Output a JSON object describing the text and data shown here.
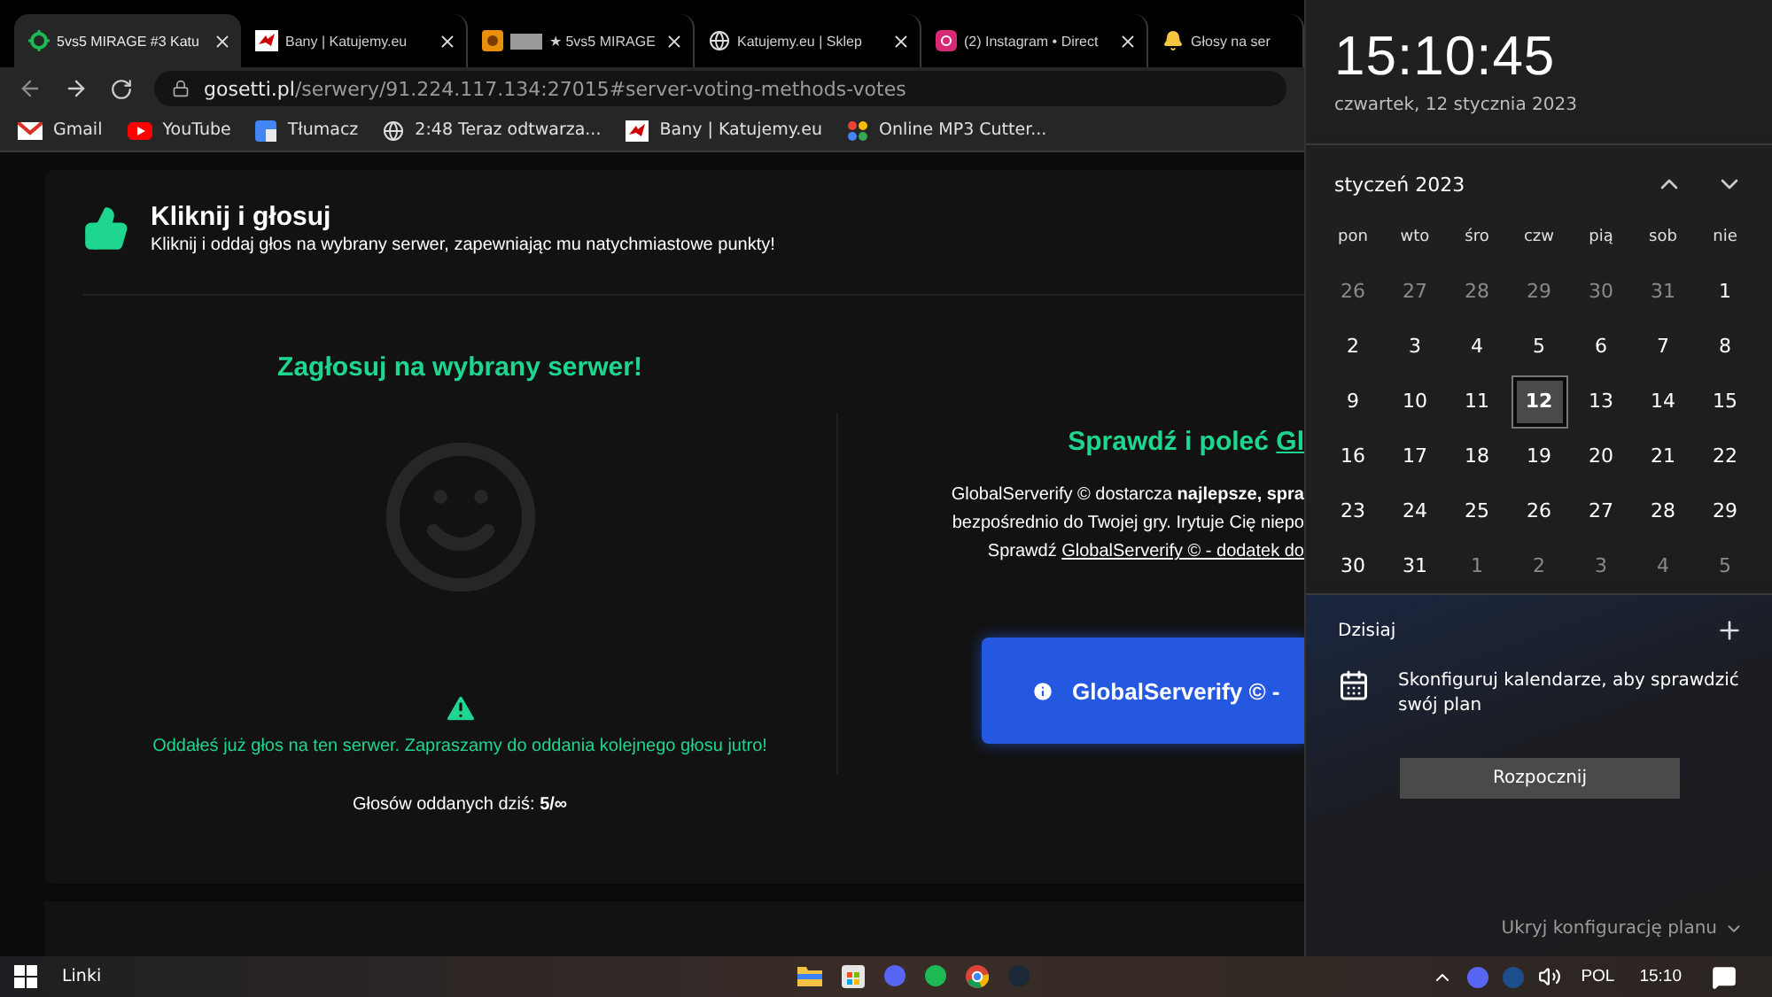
{
  "browser": {
    "tabs": [
      {
        "title": "5vs5 MIRAGE #3 Katu",
        "selected": true,
        "redacted": false
      },
      {
        "title": "Bany | Katujemy.eu",
        "selected": false,
        "redacted": false
      },
      {
        "title": "★ 5vs5 MIRAGE",
        "selected": false,
        "redacted": true
      },
      {
        "title": "Katujemy.eu | Sklep",
        "selected": false,
        "redacted": false
      },
      {
        "title": "(2) Instagram • Direct",
        "selected": false,
        "redacted": false
      },
      {
        "title": "Głosy na ser",
        "selected": false,
        "redacted": false
      }
    ],
    "address": {
      "host": "gosetti.pl",
      "path": "/serwery/91.224.117.134:27015#server-voting-methods-votes"
    },
    "bookmarks": [
      "Gmail",
      "YouTube",
      "Tłumacz",
      "2:48 Teraz odtwarza...",
      "Bany | Katujemy.eu",
      "Online MP3 Cutter..."
    ]
  },
  "page": {
    "title": "Kliknij i głosuj",
    "subtitle": "Kliknij i oddaj głos na wybrany serwer, zapewniając mu natychmiastowe punkty!",
    "vote": {
      "heading": "Zagłosuj na wybrany serwer!",
      "notice": "Oddałeś już głos na ten serwer. Zapraszamy do oddania kolejnego głosu jutro!",
      "count": "Głosów oddanych dziś: **5/∞**"
    },
    "promo": {
      "heading": "Sprawdź i poleć",
      "heading_link": "Gl",
      "line_1": "GlobalServerify © dostarcza **najlepsze, spra**",
      "line_2": "bezpośrednio do Twojej gry. Irytuje Cię niepo",
      "line_3": "Sprawdź",
      "line_3_link": "GlobalServerify © - dodatek do",
      "button": "GlobalServerify © -"
    }
  },
  "clock": {
    "time": "15:10:45",
    "date": "czwartek, 12 stycznia 2023",
    "month": "styczeń 2023",
    "weekdays": [
      "pon",
      "wto",
      "śro",
      "czw",
      "pią",
      "sob",
      "nie"
    ],
    "days": [
      {
        "day": "26",
        "in_month": false,
        "selected": false
      },
      {
        "day": "27",
        "in_month": false,
        "selected": false
      },
      {
        "day": "28",
        "in_month": false,
        "selected": false
      },
      {
        "day": "29",
        "in_month": false,
        "selected": false
      },
      {
        "day": "30",
        "in_month": false,
        "selected": false
      },
      {
        "day": "31",
        "in_month": false,
        "selected": false
      },
      {
        "day": "1",
        "in_month": true,
        "selected": false
      },
      {
        "day": "2",
        "in_month": true,
        "selected": false
      },
      {
        "day": "3",
        "in_month": true,
        "selected": false
      },
      {
        "day": "4",
        "in_month": true,
        "selected": false
      },
      {
        "day": "5",
        "in_month": true,
        "selected": false
      },
      {
        "day": "6",
        "in_month": true,
        "selected": false
      },
      {
        "day": "7",
        "in_month": true,
        "selected": false
      },
      {
        "day": "8",
        "in_month": true,
        "selected": false
      },
      {
        "day": "9",
        "in_month": true,
        "selected": false
      },
      {
        "day": "10",
        "in_month": true,
        "selected": false
      },
      {
        "day": "11",
        "in_month": true,
        "selected": false
      },
      {
        "day": "12",
        "in_month": true,
        "selected": true
      },
      {
        "day": "13",
        "in_month": true,
        "selected": false
      },
      {
        "day": "14",
        "in_month": true,
        "selected": false
      },
      {
        "day": "15",
        "in_month": true,
        "selected": false
      },
      {
        "day": "16",
        "in_month": true,
        "selected": false
      },
      {
        "day": "17",
        "in_month": true,
        "selected": false
      },
      {
        "day": "18",
        "in_month": true,
        "selected": false
      },
      {
        "day": "19",
        "in_month": true,
        "selected": false
      },
      {
        "day": "20",
        "in_month": true,
        "selected": false
      },
      {
        "day": "21",
        "in_month": true,
        "selected": false
      },
      {
        "day": "22",
        "in_month": true,
        "selected": false
      },
      {
        "day": "23",
        "in_month": true,
        "selected": false
      },
      {
        "day": "24",
        "in_month": true,
        "selected": false
      },
      {
        "day": "25",
        "in_month": true,
        "selected": false
      },
      {
        "day": "26",
        "in_month": true,
        "selected": false
      },
      {
        "day": "27",
        "in_month": true,
        "selected": false
      },
      {
        "day": "28",
        "in_month": true,
        "selected": false
      },
      {
        "day": "29",
        "in_month": true,
        "selected": false
      },
      {
        "day": "30",
        "in_month": true,
        "selected": false
      },
      {
        "day": "31",
        "in_month": true,
        "selected": false
      },
      {
        "day": "1",
        "in_month": false,
        "selected": false
      },
      {
        "day": "2",
        "in_month": false,
        "selected": false
      },
      {
        "day": "3",
        "in_month": false,
        "selected": false
      },
      {
        "day": "4",
        "in_month": false,
        "selected": false
      },
      {
        "day": "5",
        "in_month": false,
        "selected": false
      }
    ],
    "agenda_title": "Dzisiaj",
    "agenda_message": "Skonfiguruj kalendarze, aby sprawdzić swój plan",
    "agenda_button": "Rozpocznij",
    "hide_link": "Ukryj konfigurację planu"
  },
  "taskbar": {
    "links": "Linki",
    "language": "POL",
    "time": "15:10"
  }
}
